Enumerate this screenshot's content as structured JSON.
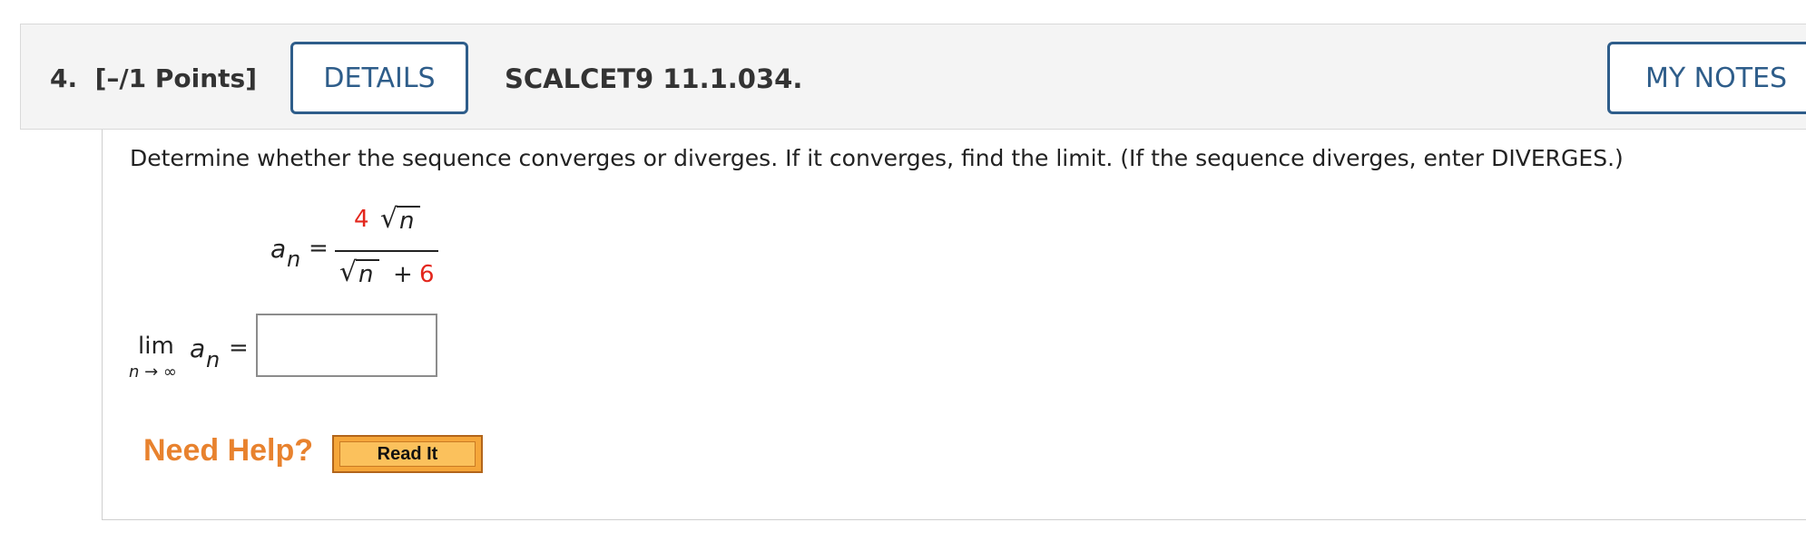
{
  "header": {
    "question_number": "4.",
    "points": "[–/1 Points]",
    "details_label": "DETAILS",
    "question_code": "SCALCET9 11.1.034.",
    "my_notes_label": "MY NOTES"
  },
  "question": {
    "prompt": "Determine whether the sequence converges or diverges. If it converges, find the limit. (If the sequence diverges, enter DIVERGES.)",
    "formula": {
      "lhs_var": "a",
      "lhs_sub": "n",
      "equals": "=",
      "numerator_coef": "4",
      "radical": "√",
      "radicand": "n",
      "plus": "+",
      "denominator_const": "6"
    },
    "limit": {
      "lim": "lim",
      "under": "n → ∞",
      "var": "a",
      "sub": "n",
      "equals": "=",
      "answer_value": ""
    }
  },
  "help": {
    "need_help_label": "Need Help?",
    "read_it_label": "Read It"
  },
  "colors": {
    "accent_blue": "#2e5d8a",
    "red_value": "#e3261c",
    "help_orange": "#e8822e"
  }
}
